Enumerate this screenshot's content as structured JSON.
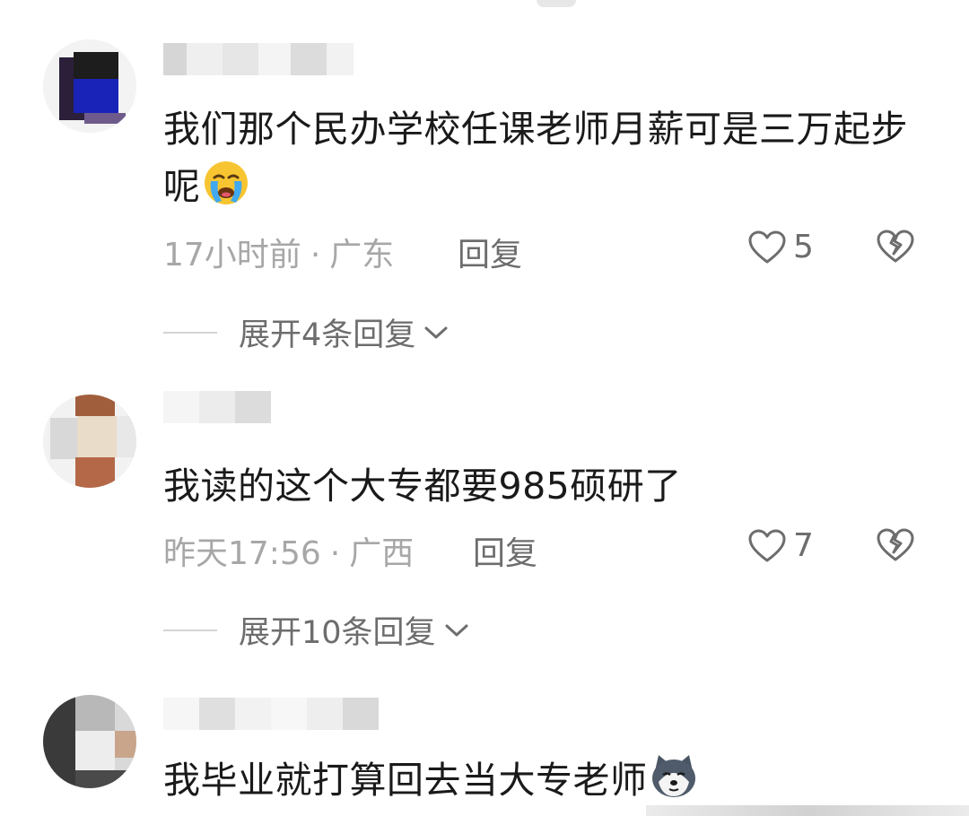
{
  "comments": [
    {
      "username": "",
      "text": "我们那个民办学校任课老师月薪可是三万起步呢",
      "emoji": "crying-face-emoji",
      "time": "17小时前",
      "location": "广东",
      "reply_label": "回复",
      "likes": "5",
      "expand_label": "展开4条回复"
    },
    {
      "username": "",
      "text": "我读的这个大专都要985硕研了",
      "time": "昨天17:56",
      "location": "广西",
      "reply_label": "回复",
      "likes": "7",
      "expand_label": "展开10条回复"
    },
    {
      "username": "",
      "text": "我毕业就打算回去当大专老师",
      "emoji": "husky-doge-emoji"
    }
  ],
  "meta": {
    "separator": "·"
  },
  "colors": {
    "text": "#1a1a1a",
    "meta": "#a7a7a7",
    "action": "#6d6d6d",
    "divider": "#d4d4d4"
  }
}
